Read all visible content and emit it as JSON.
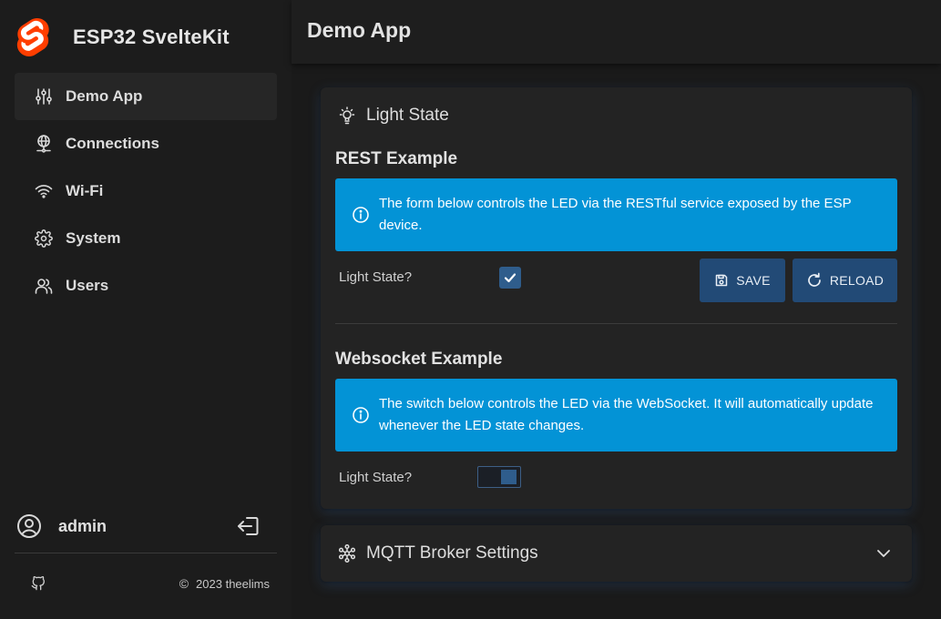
{
  "app": {
    "brand_title": "ESP32 SvelteKit",
    "page_title": "Demo App"
  },
  "sidebar": {
    "items": [
      {
        "label": "Demo App",
        "icon": "sliders-icon",
        "active": true
      },
      {
        "label": "Connections",
        "icon": "globe-network-icon",
        "active": false
      },
      {
        "label": "Wi-Fi",
        "icon": "wifi-icon",
        "active": false
      },
      {
        "label": "System",
        "icon": "gear-icon",
        "active": false
      },
      {
        "label": "Users",
        "icon": "users-icon",
        "active": false
      }
    ],
    "user_name": "admin",
    "footer_copyright": "2023 theelims"
  },
  "light_card": {
    "title": "Light State",
    "rest": {
      "heading": "REST Example",
      "info": "The form below controls the LED via the RESTful service exposed by the ESP device.",
      "field_label": "Light State?",
      "checked": true,
      "save_label": "SAVE",
      "reload_label": "RELOAD"
    },
    "websocket": {
      "heading": "Websocket Example",
      "info": "The switch below controls the LED via the WebSocket. It will automatically update whenever the LED state changes.",
      "field_label": "Light State?",
      "toggled_on": true
    }
  },
  "mqtt_card": {
    "title": "MQTT Broker Settings"
  },
  "colors": {
    "background": "#1a1a1a",
    "card": "#232323",
    "info": "#0393d6",
    "button": "#224a76",
    "accent": "#2f5d8c",
    "logo": "#ff3e00"
  }
}
